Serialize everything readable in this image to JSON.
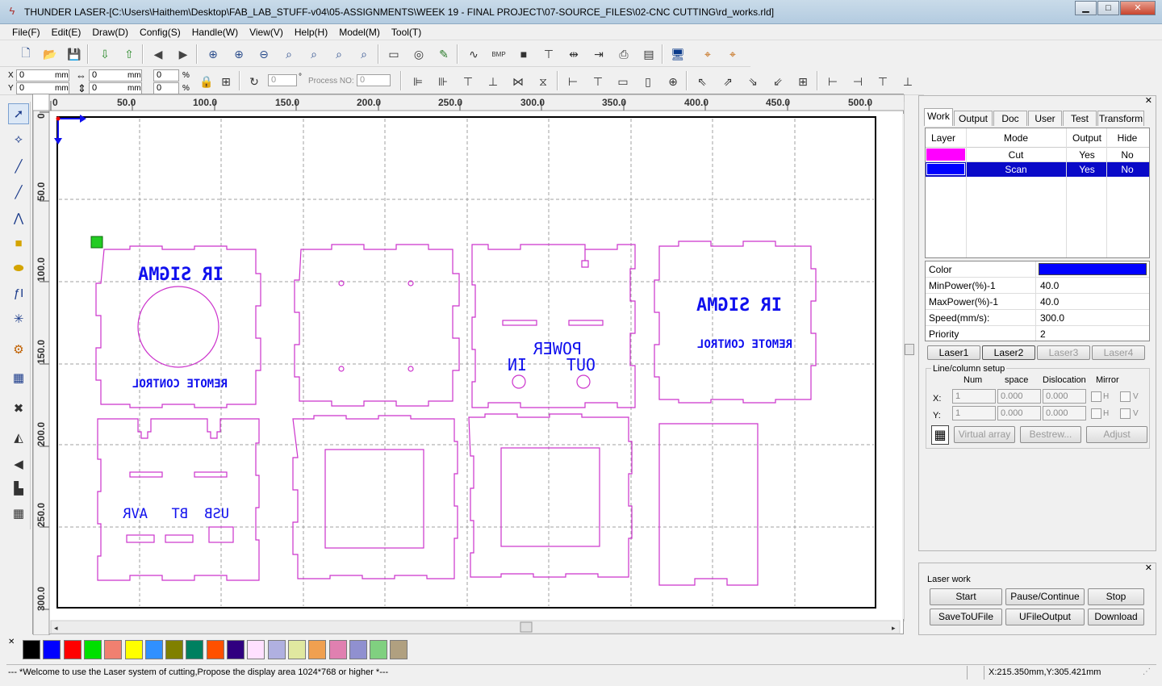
{
  "window": {
    "title": "THUNDER LASER-[C:\\Users\\Haithem\\Desktop\\FAB_LAB_STUFF-v04\\05-ASSIGNMENTS\\WEEK 19 - FINAL PROJECT\\07-SOURCE_FILES\\02-CNC CUTTING\\rd_works.rld]"
  },
  "menu": [
    "File(F)",
    "Edit(E)",
    "Draw(D)",
    "Config(S)",
    "Handle(W)",
    "View(V)",
    "Help(H)",
    "Model(M)",
    "Tool(T)"
  ],
  "coords": {
    "x_label": "X",
    "y_label": "Y",
    "x_val": "0",
    "y_val": "0",
    "unit": "mm",
    "w_val": "0",
    "h_val": "0",
    "w_pct": "0",
    "h_pct": "0",
    "pct": "%",
    "rot_val": "0",
    "deg": "°",
    "process_no_label": "Process NO:",
    "process_no_val": "0"
  },
  "ruler": {
    "top": [
      "0",
      "50.0",
      "100.0",
      "150.0",
      "200.0",
      "250.0",
      "300.0",
      "350.0",
      "400.0",
      "450.0",
      "500.0"
    ],
    "left": [
      "0",
      "50.0",
      "100.0",
      "150.0",
      "200.0",
      "250.0",
      "300.0"
    ]
  },
  "drawing": {
    "texts": [
      {
        "text": "IR SIGMA"
      },
      {
        "text": "REMOTE CONTROL"
      },
      {
        "text": "POWER"
      },
      {
        "text": "IN"
      },
      {
        "text": "OUT"
      },
      {
        "text": "IR SIGMA"
      },
      {
        "text": "REMOTE CONTROL"
      },
      {
        "text": "AVR"
      },
      {
        "text": "BT"
      },
      {
        "text": "USB"
      }
    ],
    "cut_color": "#cc33cc",
    "scan_color": "#1010ee"
  },
  "panel": {
    "tabs": [
      "Work",
      "Output",
      "Doc",
      "User",
      "Test",
      "Transform"
    ],
    "active_tab": "Work",
    "layer_headers": [
      "Layer",
      "Mode",
      "Output",
      "Hide"
    ],
    "layers": [
      {
        "color": "#ff00ff",
        "mode": "Cut",
        "output": "Yes",
        "hide": "No"
      },
      {
        "color": "#0000ff",
        "mode": "Scan",
        "output": "Yes",
        "hide": "No"
      }
    ],
    "props": [
      {
        "label": "Color",
        "value": ""
      },
      {
        "label": "MinPower(%)-1",
        "value": "40.0"
      },
      {
        "label": "MaxPower(%)-1",
        "value": "40.0"
      },
      {
        "label": "Speed(mm/s):",
        "value": "300.0"
      },
      {
        "label": "Priority",
        "value": "2"
      }
    ],
    "prop_color": "#0000ff",
    "lasers": [
      "Laser1",
      "Laser2",
      "Laser3",
      "Laser4"
    ],
    "line_setup": {
      "title": "Line/column setup",
      "cols": [
        "Num",
        "space",
        "Dislocation",
        "Mirror"
      ],
      "x_label": "X:",
      "y_label": "Y:",
      "x": [
        "1",
        "0.000",
        "0.000"
      ],
      "y": [
        "1",
        "0.000",
        "0.000"
      ],
      "h": "H",
      "v": "V"
    },
    "array_buttons": [
      "Virtual array",
      "Bestrew...",
      "Adjust"
    ]
  },
  "laser_work": {
    "title": "Laser work",
    "buttons": [
      "Start",
      "Pause/Continue",
      "Stop",
      "SaveToUFile",
      "UFileOutput",
      "Download"
    ]
  },
  "palette": [
    "#000000",
    "#0000ff",
    "#ff0000",
    "#00e000",
    "#f08070",
    "#ffff00",
    "#3090ff",
    "#808000",
    "#008060",
    "#ff5000",
    "#300080",
    "#ffe0ff",
    "#b0b0e0",
    "#e0e8a0",
    "#f0a050",
    "#e080b0",
    "#9090d0",
    "#80d080",
    "#b0a080"
  ],
  "status": {
    "message": "--- *Welcome to use the Laser system of cutting,Propose the display area 1024*768 or higher *---",
    "coords": "X:215.350mm,Y:305.421mm"
  }
}
